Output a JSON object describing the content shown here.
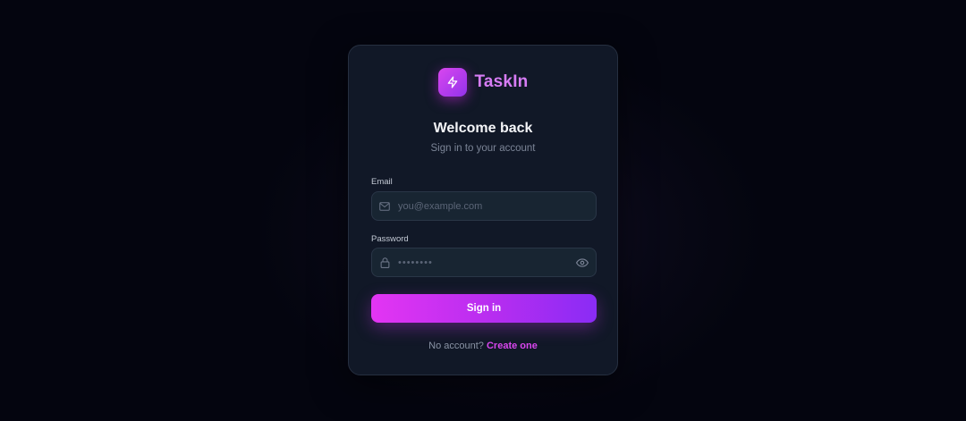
{
  "brand": {
    "name": "TaskIn",
    "logo_icon": "lightning-bolt-icon",
    "accent_color": "#d946ef"
  },
  "header": {
    "title": "Welcome back",
    "subtitle": "Sign in to your account"
  },
  "form": {
    "email": {
      "label": "Email",
      "placeholder": "you@example.com",
      "value": "",
      "icon": "mail-icon"
    },
    "password": {
      "label": "Password",
      "placeholder": "••••••••",
      "value": "",
      "icon": "lock-icon",
      "toggle_icon": "eye-icon"
    },
    "submit_label": "Sign in"
  },
  "footer": {
    "prompt": "No account?",
    "link_label": "Create one"
  }
}
